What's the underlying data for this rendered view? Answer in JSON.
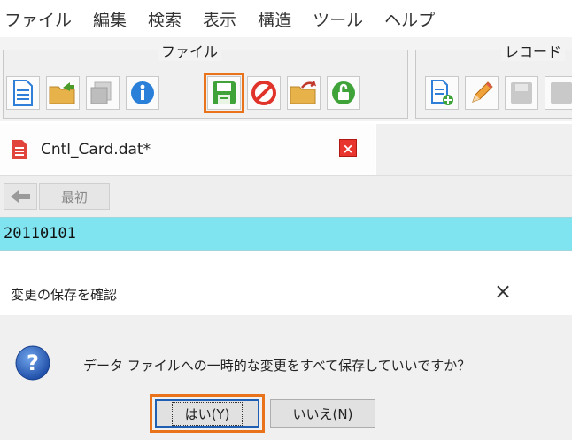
{
  "menu": [
    "ファイル",
    "編集",
    "検索",
    "表示",
    "構造",
    "ツール",
    "ヘルプ"
  ],
  "toolbar": {
    "file_group_label": "ファイル",
    "record_group_label": "レコード",
    "highlighted_button": "save"
  },
  "tab": {
    "label": "Cntl_Card.dat*",
    "close": "×"
  },
  "nav": {
    "first_label": "最初"
  },
  "record": {
    "value": "20110101"
  },
  "dialog": {
    "title": "変更の保存を確認",
    "close": "×",
    "message": "データ ファイルへの一時的な変更をすべて保存していいですか？",
    "yes_label": "はい(Y)",
    "no_label": "いいえ(N)"
  },
  "colors": {
    "highlight": "#e8731a",
    "record_row": "#7fe3f0",
    "accent": "#1e5fb3"
  }
}
